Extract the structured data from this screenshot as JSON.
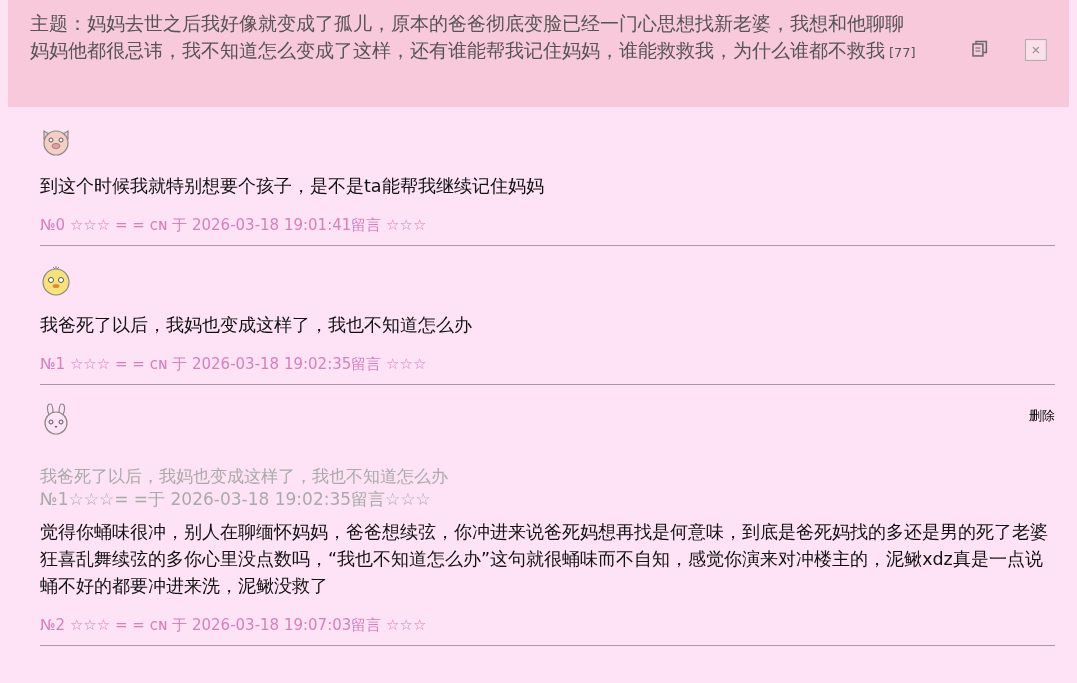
{
  "topic": {
    "title": "主题：妈妈去世之后我好像就变成了孤儿，原本的爸爸彻底变脸已经一门心思想找新老婆，我想和他聊聊妈妈他都很忌讳，我不知道怎么变成了这样，还有谁能帮我记住妈妈，谁能救救我，为什么谁都不救我",
    "count": "[77]"
  },
  "posts": [
    {
      "avatar": {
        "kind": "pig"
      },
      "body": "到这个时候我就特别想要个孩子，是不是ta能帮我继续记住妈妈",
      "meta": "№0 ☆☆☆ = = ᴄɴ 于 2026-03-18 19:01:41留言 ☆☆☆"
    },
    {
      "avatar": {
        "kind": "chick"
      },
      "body": "我爸死了以后，我妈也变成这样了，我也不知道怎么办",
      "meta": "№1 ☆☆☆ = = ᴄɴ 于 2026-03-18 19:02:35留言 ☆☆☆"
    },
    {
      "avatar": {
        "kind": "rabbit"
      },
      "delete": "删除",
      "quote": {
        "body": "我爸死了以后，我妈也变成这样了，我也不知道怎么办",
        "meta": "№1☆☆☆= =于 2026-03-18 19:02:35留言☆☆☆"
      },
      "body": "觉得你蛹味很冲，别人在聊缅怀妈妈，爸爸想续弦，你冲进来说爸死妈想再找是何意味，到底是爸死妈找的多还是男的死了老婆狂喜乱舞续弦的多你心里没点数吗，“我也不知道怎么办”这句就很蛹味而不自知，感觉你演来对冲楼主的，泥鳅xdz真是一点说蛹不好的都要冲进来洗，泥鳅没救了",
      "meta": "№2 ☆☆☆ = = ᴄɴ 于 2026-03-18 19:07:03留言 ☆☆☆"
    }
  ]
}
